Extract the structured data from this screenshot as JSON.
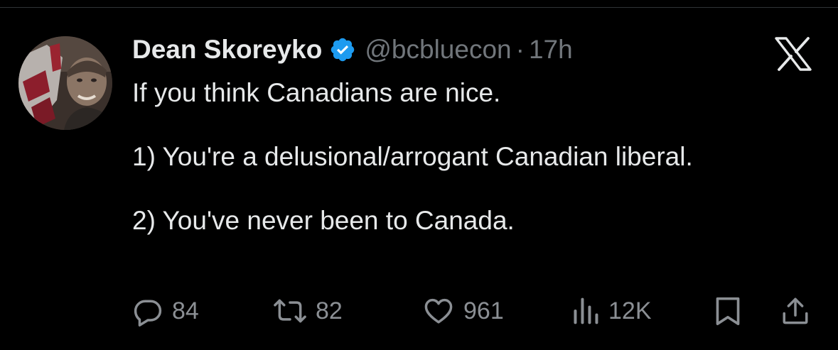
{
  "tweet": {
    "author_name": "Dean Skoreyko",
    "handle": "@bcbluecon",
    "separator": "·",
    "time": "17h",
    "lines": [
      "If you think Canadians are nice.",
      "",
      "1) You're a delusional/arrogant Canadian liberal.",
      "",
      "2) You've never been to Canada."
    ]
  },
  "stats": {
    "replies": "84",
    "reposts": "82",
    "likes": "961",
    "views": "12K"
  },
  "icons": {
    "verified": "verified-badge-icon",
    "brand": "x-logo-icon",
    "reply": "reply-icon",
    "repost": "repost-icon",
    "like": "heart-icon",
    "views": "views-icon",
    "bookmark": "bookmark-icon",
    "share": "share-icon"
  },
  "colors": {
    "background": "#000000",
    "text": "#e7e9ea",
    "secondary_text": "#71767b",
    "verified_blue": "#1d9bf0"
  }
}
